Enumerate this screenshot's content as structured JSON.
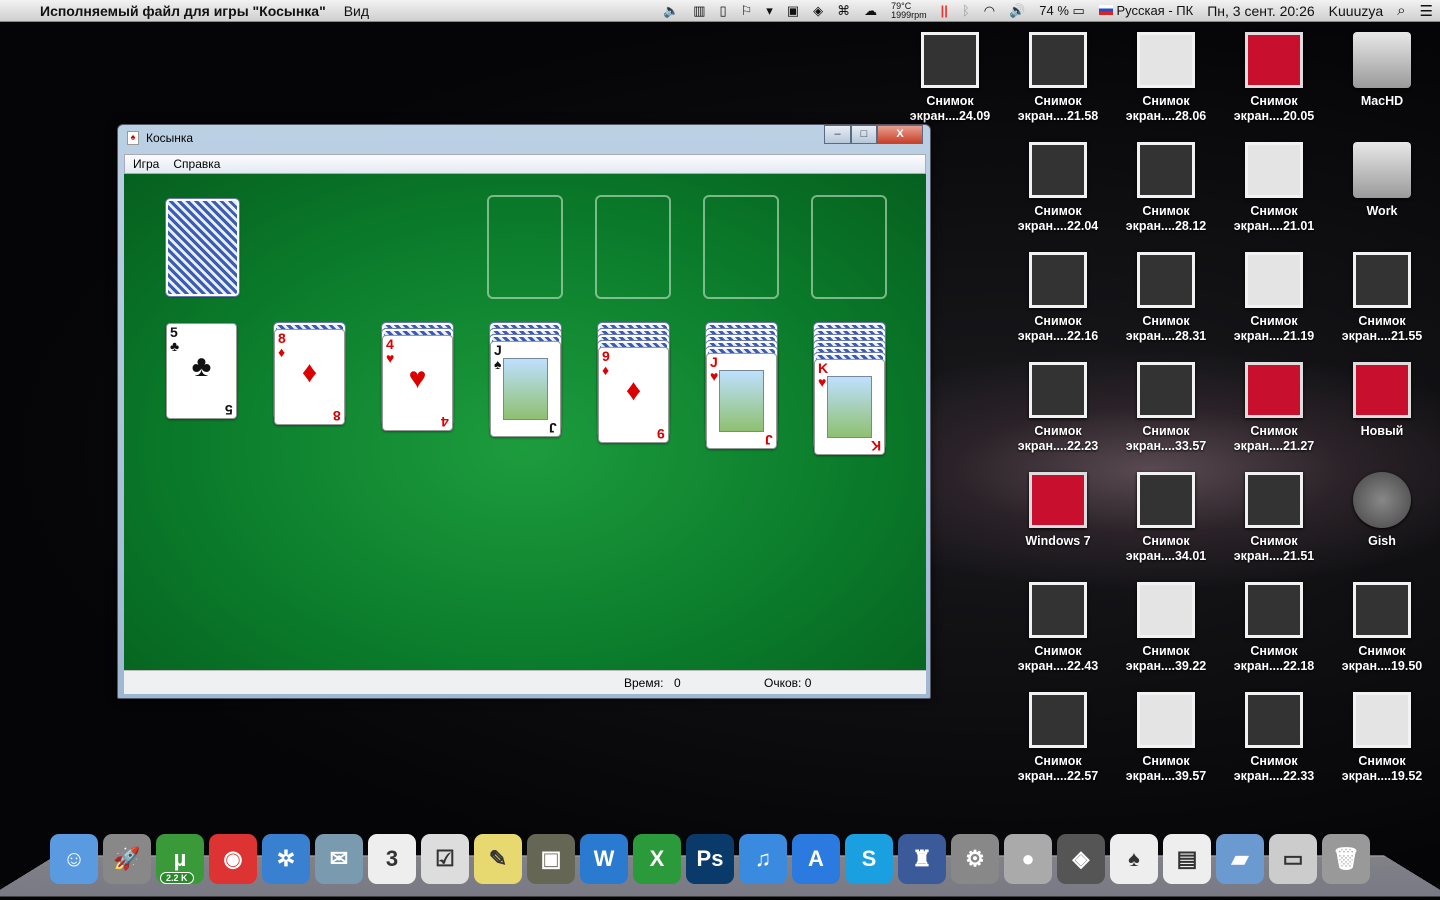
{
  "menubar": {
    "app_title": "Исполняемый файл для игры \"Косынка\"",
    "menu_view": "Вид",
    "temp": "79°C",
    "rpm": "1999rpm",
    "battery": "74 %",
    "input_source": "Русская - ПК",
    "datetime": "Пн, 3 сент.  20:26",
    "user": "Kuuuzya"
  },
  "desktop_icons": [
    {
      "label1": "Снимок",
      "label2": "экран....24.09",
      "col": 0,
      "row": 0,
      "kind": "shot"
    },
    {
      "label1": "Снимок",
      "label2": "экран....21.58",
      "col": 1,
      "row": 0,
      "kind": "shot"
    },
    {
      "label1": "Снимок",
      "label2": "экран....28.06",
      "col": 2,
      "row": 0,
      "kind": "light"
    },
    {
      "label1": "Снимок",
      "label2": "экран....20.05",
      "col": 3,
      "row": 0,
      "kind": "par"
    },
    {
      "label1": "MacHD",
      "label2": "",
      "col": 4,
      "row": 0,
      "kind": "hd"
    },
    {
      "label1": "Снимок",
      "label2": "экран....22.04",
      "col": 1,
      "row": 1,
      "kind": "shot"
    },
    {
      "label1": "Снимок",
      "label2": "экран....28.12",
      "col": 2,
      "row": 1,
      "kind": "shot"
    },
    {
      "label1": "Снимок",
      "label2": "экран....21.01",
      "col": 3,
      "row": 1,
      "kind": "light"
    },
    {
      "label1": "Work",
      "label2": "",
      "col": 4,
      "row": 1,
      "kind": "hd"
    },
    {
      "label1": "Снимок",
      "label2": "экран....22.16",
      "col": 1,
      "row": 2,
      "kind": "shot"
    },
    {
      "label1": "Снимок",
      "label2": "экран....28.31",
      "col": 2,
      "row": 2,
      "kind": "shot"
    },
    {
      "label1": "Снимок",
      "label2": "экран....21.19",
      "col": 3,
      "row": 2,
      "kind": "light"
    },
    {
      "label1": "Снимок",
      "label2": "экран....21.55",
      "col": 4,
      "row": 2,
      "kind": "shot"
    },
    {
      "label1": "Снимок",
      "label2": "экран....22.23",
      "col": 1,
      "row": 3,
      "kind": "shot"
    },
    {
      "label1": "Снимок",
      "label2": "экран....33.57",
      "col": 2,
      "row": 3,
      "kind": "shot"
    },
    {
      "label1": "Снимок",
      "label2": "экран....21.27",
      "col": 3,
      "row": 3,
      "kind": "par"
    },
    {
      "label1": "Новый",
      "label2": "",
      "col": 4,
      "row": 3,
      "kind": "par"
    },
    {
      "label1": "Windows 7",
      "label2": "",
      "col": 1,
      "row": 4,
      "kind": "par"
    },
    {
      "label1": "Снимок",
      "label2": "экран....34.01",
      "col": 2,
      "row": 4,
      "kind": "shot"
    },
    {
      "label1": "Снимок",
      "label2": "экран....21.51",
      "col": 3,
      "row": 4,
      "kind": "shot"
    },
    {
      "label1": "Gish",
      "label2": "",
      "col": 4,
      "row": 4,
      "kind": "steam"
    },
    {
      "label1": "Снимок",
      "label2": "экран....22.43",
      "col": 1,
      "row": 5,
      "kind": "shot"
    },
    {
      "label1": "Снимок",
      "label2": "экран....39.22",
      "col": 2,
      "row": 5,
      "kind": "light"
    },
    {
      "label1": "Снимок",
      "label2": "экран....22.18",
      "col": 3,
      "row": 5,
      "kind": "shot"
    },
    {
      "label1": "Снимок",
      "label2": "экран....19.50",
      "col": 4,
      "row": 5,
      "kind": "shot"
    },
    {
      "label1": "Снимок",
      "label2": "экран....22.57",
      "col": 1,
      "row": 6,
      "kind": "shot"
    },
    {
      "label1": "Снимок",
      "label2": "экран....39.57",
      "col": 2,
      "row": 6,
      "kind": "light"
    },
    {
      "label1": "Снимок",
      "label2": "экран....22.33",
      "col": 3,
      "row": 6,
      "kind": "shot"
    },
    {
      "label1": "Снимок",
      "label2": "экран....19.52",
      "col": 4,
      "row": 6,
      "kind": "light"
    }
  ],
  "window": {
    "title": "Косынка",
    "menu": [
      "Игра",
      "Справка"
    ],
    "status_time_label": "Время:",
    "status_time": "0",
    "status_score": "Очков: 0",
    "minimize": "–",
    "maximize": "□",
    "close": "X"
  },
  "tableau": [
    {
      "hidden": 0,
      "rank": "5",
      "suit": "♣",
      "color": "blk",
      "face": false
    },
    {
      "hidden": 1,
      "rank": "8",
      "suit": "♦",
      "color": "red",
      "face": false
    },
    {
      "hidden": 2,
      "rank": "4",
      "suit": "♥",
      "color": "red",
      "face": false
    },
    {
      "hidden": 3,
      "rank": "J",
      "suit": "♠",
      "color": "blk",
      "face": true
    },
    {
      "hidden": 4,
      "rank": "9",
      "suit": "♦",
      "color": "red",
      "face": false
    },
    {
      "hidden": 5,
      "rank": "J",
      "suit": "♥",
      "color": "red",
      "face": true
    },
    {
      "hidden": 6,
      "rank": "K",
      "suit": "♥",
      "color": "red",
      "face": true
    }
  ],
  "dock": [
    {
      "name": "finder",
      "glyph": "☺",
      "bg": "#5a9ae0"
    },
    {
      "name": "launchpad",
      "glyph": "🚀",
      "bg": "#888"
    },
    {
      "name": "utorrent",
      "glyph": "µ",
      "bg": "#3a9a3a",
      "badge": "2.2 K"
    },
    {
      "name": "chrome",
      "glyph": "◉",
      "bg": "#d33"
    },
    {
      "name": "safari",
      "glyph": "✲",
      "bg": "#3a80d0"
    },
    {
      "name": "mail",
      "glyph": "✉",
      "bg": "#7a9ab0"
    },
    {
      "name": "calendar",
      "glyph": "3",
      "bg": "#eee"
    },
    {
      "name": "reminders",
      "glyph": "☑",
      "bg": "#ddd"
    },
    {
      "name": "stickies",
      "glyph": "✎",
      "bg": "#e8d870"
    },
    {
      "name": "iphoto",
      "glyph": "▣",
      "bg": "#665"
    },
    {
      "name": "word",
      "glyph": "W",
      "bg": "#2a7ad0"
    },
    {
      "name": "excel",
      "glyph": "X",
      "bg": "#2a9a3a"
    },
    {
      "name": "photoshop",
      "glyph": "Ps",
      "bg": "#0a3a6a"
    },
    {
      "name": "itunes",
      "glyph": "♫",
      "bg": "#3a8ae0"
    },
    {
      "name": "app-store",
      "glyph": "A",
      "bg": "#2a7ae0"
    },
    {
      "name": "skype",
      "glyph": "S",
      "bg": "#1aa0e0"
    },
    {
      "name": "automator",
      "glyph": "♜",
      "bg": "#3a5a9a"
    },
    {
      "name": "system-preferences",
      "glyph": "⚙",
      "bg": "#888"
    },
    {
      "name": "robot-app",
      "glyph": "●",
      "bg": "#aaa"
    },
    {
      "name": "steam",
      "glyph": "◈",
      "bg": "#555"
    },
    {
      "name": "solitaire",
      "glyph": "♠",
      "bg": "#eee"
    },
    {
      "name": "document",
      "glyph": "▤",
      "bg": "#eee"
    },
    {
      "name": "folder",
      "glyph": "▰",
      "bg": "#6a9ad0"
    },
    {
      "name": "window-stack",
      "glyph": "▭",
      "bg": "#ccc"
    },
    {
      "name": "trash",
      "glyph": "🗑",
      "bg": "#999"
    }
  ]
}
